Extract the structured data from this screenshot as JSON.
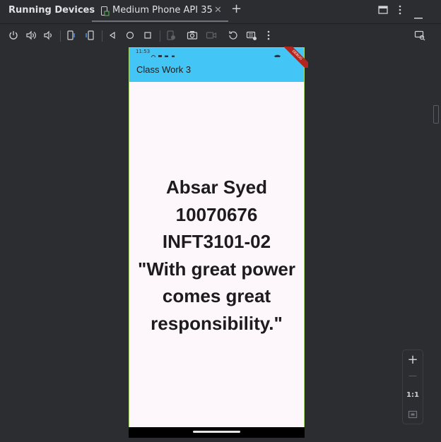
{
  "titlebar": {
    "title": "Running Devices",
    "tab": {
      "label": "Medium Phone API 35",
      "close": "✕"
    },
    "add": "+"
  },
  "toolbar": {
    "icons": [
      "power-icon",
      "volume-up-icon",
      "volume-down-icon",
      "rotate-left-icon",
      "rotate-right-icon",
      "back-icon",
      "home-icon",
      "overview-icon",
      "fold-icon",
      "screenshot-icon",
      "screen-record-icon",
      "reset-icon",
      "keyboard-icon",
      "more-icon",
      "device-mirror-icon"
    ]
  },
  "phone": {
    "status_time": "11:53",
    "app_title": "Class Work 3",
    "debug_banner": "DEBUG",
    "lines": [
      "Absar Syed",
      "10070676",
      "INFT3101-02",
      "\"With great power",
      "comes great",
      "responsibility.\""
    ]
  },
  "zoom": {
    "in": "+",
    "out": "—",
    "actual": "1:1"
  }
}
